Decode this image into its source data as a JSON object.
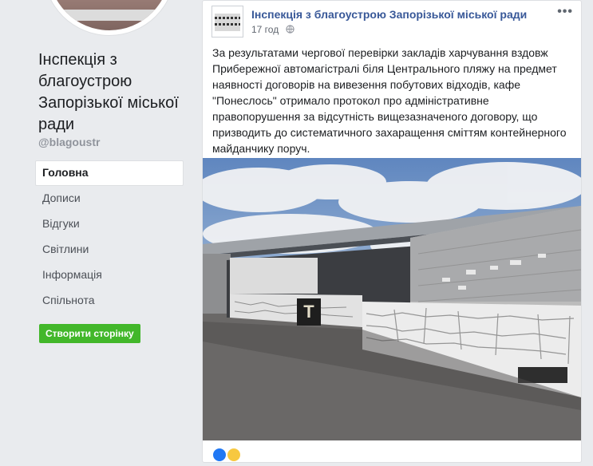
{
  "sidebar": {
    "page_name": "Інспекція з благоустрою Запорізької міської ради",
    "handle": "@blagoustr",
    "nav": [
      {
        "label": "Головна",
        "active": true
      },
      {
        "label": "Дописи"
      },
      {
        "label": "Відгуки"
      },
      {
        "label": "Світлини"
      },
      {
        "label": "Інформація"
      },
      {
        "label": "Спільнота"
      }
    ],
    "create_page_label": "Створити сторінку"
  },
  "post": {
    "author": "Інспекція з благоустрою Запорізької міської ради",
    "time": "17 год",
    "more_icon": "more-horizontal-icon",
    "privacy_icon": "globe-icon",
    "text": "За результатами чергової перевірки закладів харчування вздовж Прибережної автомагістралі біля Центрального пляжу на предмет наявності договорів на вивезення побутових відходів, кафе \"Понеслось\" отримало протокол про адміністративне правопорушення за відсутність вищезазначеного договору, що призводить до систематичного захаращення сміттям контейнерного майданчику поруч.",
    "photo_sign_letter": "T",
    "reactions": [
      "like",
      "wow"
    ]
  },
  "colors": {
    "link": "#385898",
    "green_button": "#42b72a",
    "background": "#e9ebee"
  }
}
